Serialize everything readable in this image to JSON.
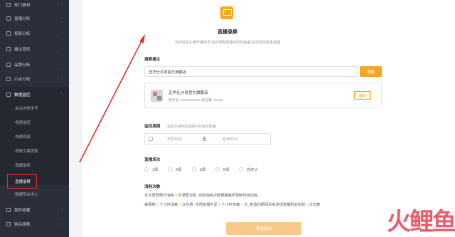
{
  "sidebar": {
    "items": [
      {
        "label": "热门素材",
        "chev": "›"
      },
      {
        "label": "直播分析",
        "chev": "›"
      },
      {
        "label": "视频分析",
        "chev": "›"
      },
      {
        "label": "播主查找",
        "chev": "›"
      },
      {
        "label": "品牌分析",
        "chev": "›"
      },
      {
        "label": "小店分析",
        "chev": "›"
      },
      {
        "label": "数据监控",
        "chev": "⌃"
      }
    ],
    "sub_items": [
      {
        "label": "· 关注的快手号"
      },
      {
        "label": "· 视频监控"
      },
      {
        "label": "· 视频回采"
      },
      {
        "label": "· 视频文案提取"
      },
      {
        "label": "· 直播监控"
      },
      {
        "label": "· 直播录屏"
      },
      {
        "label": "· 数据导出中心"
      }
    ],
    "bottom_items": [
      {
        "label": "我的收藏",
        "chev": "›"
      },
      {
        "label": "购买续费",
        "chev": "›"
      }
    ]
  },
  "main": {
    "title": "直播录屏",
    "subtitle": "实时监控主播开播状态,自动录制直播间现场画面,助您高效复盘直播",
    "search_section_label": "搜索播主",
    "search_value": "芝华仕沙发官方旗舰店",
    "search_button": "搜索",
    "anchor": {
      "name": "芝华仕沙发官方旗舰店",
      "meta": "快手号: CheersHome  粉丝数: 38.5w",
      "delete_label": "删除"
    },
    "monitor_section_label": "监控周期",
    "monitor_hint": "(监控开录制在此期间开始的直播)",
    "start_time_placeholder": "开始时间",
    "to_label": "至",
    "end_time_placeholder": "结束时间",
    "sessions_label": "直播场次",
    "sessions": [
      {
        "label": "1场"
      },
      {
        "label": "2场"
      },
      {
        "label": "3场"
      },
      {
        "label": "5场"
      },
      {
        "label": "自定义"
      }
    ],
    "consume_label": "消耗次数",
    "consume_line1": {
      "a": "本次录屏预计消耗 ",
      "n1": "0",
      "b": " 次录屏次数, 实际消耗次数根据最终录制时间扣除。"
    },
    "consume_line2": {
      "a": "每录制 ",
      "n1": "2",
      "b": " 个小时消耗 ",
      "n2": "1",
      "c": " 次次数, 当场直播不足 ",
      "n3": "2",
      "d": " 个小时也算 ",
      "n4": "1",
      "e": " 次, 若监控期间没有发现直播则会扣除 ",
      "n5": "1",
      "f": " 次次数"
    },
    "start_button": "开始录制"
  },
  "watermark": "火鲤鱼",
  "colors": {
    "accent": "#f5a623",
    "sidebar_bg": "#2b2f3a",
    "annotation_red": "#e0322b"
  },
  "icons": [
    "fire-icon",
    "live-icon",
    "video-icon",
    "search-icon",
    "brand-icon",
    "shop-icon",
    "monitor-icon",
    "star-icon",
    "cart-icon",
    "calendar-icon",
    "tv-icon"
  ]
}
